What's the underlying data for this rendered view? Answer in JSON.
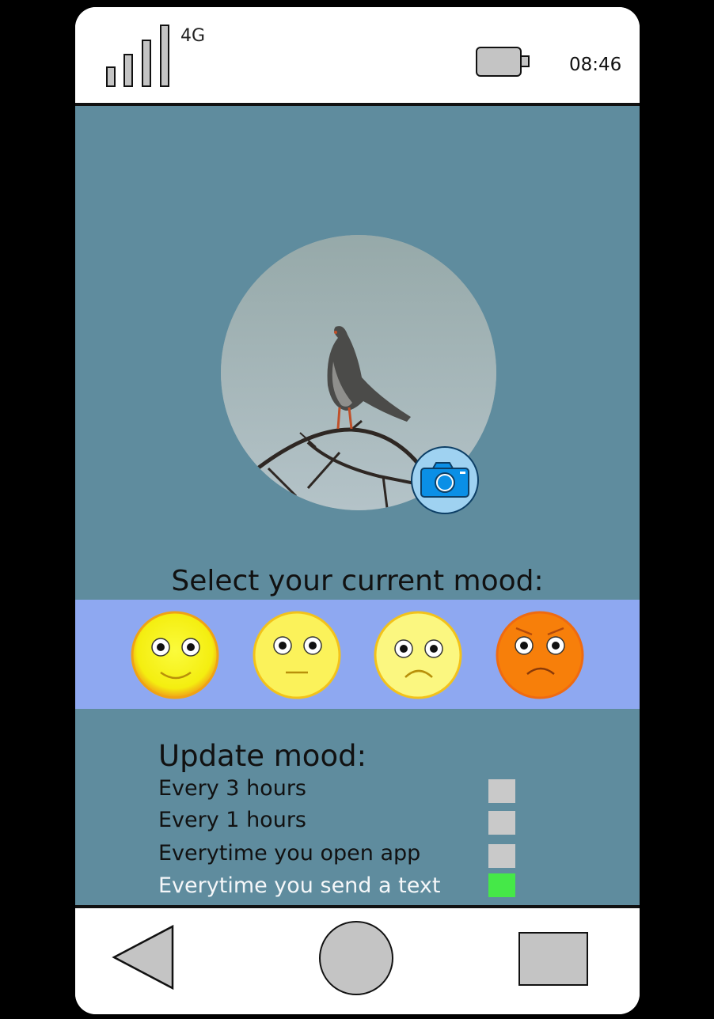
{
  "status_bar": {
    "network": "4G",
    "time": "08:46",
    "signal_icon": "signal-strength-icon",
    "battery_icon": "battery-icon"
  },
  "profile": {
    "photo_description_icon": "profile-photo",
    "camera_icon": "camera-icon"
  },
  "mood": {
    "prompt": "Select your current mood:",
    "options": [
      {
        "icon": "happy-face-icon",
        "color": "#f7f21e"
      },
      {
        "icon": "neutral-face-icon",
        "color": "#fbf35a"
      },
      {
        "icon": "sad-face-icon",
        "color": "#fbf780"
      },
      {
        "icon": "angry-face-icon",
        "color": "#f77f0a"
      }
    ]
  },
  "update": {
    "title": "Update mood:",
    "options": [
      {
        "label": "Every 3 hours",
        "checked": false
      },
      {
        "label": "Every 1 hours",
        "checked": false
      },
      {
        "label": "Everytime you open app",
        "checked": false
      },
      {
        "label": "Everytime you  send a text",
        "checked": true
      }
    ],
    "checked_color": "#45e848",
    "unchecked_color": "#c9c9c9"
  },
  "navigation": {
    "back_icon": "back-triangle-icon",
    "home_icon": "home-circle-icon",
    "recents_icon": "recents-square-icon"
  },
  "colors": {
    "background": "#5f8c9e",
    "mood_strip": "#8ea8f1"
  }
}
